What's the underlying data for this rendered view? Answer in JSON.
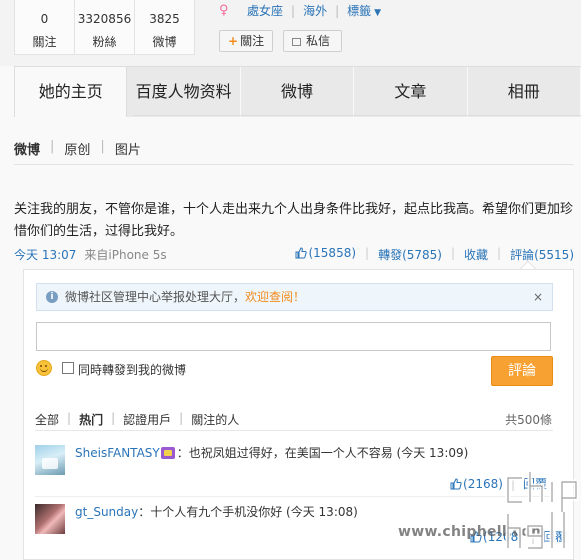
{
  "profile": {
    "stats": [
      {
        "num": "0",
        "label": "關注"
      },
      {
        "num": "3320856",
        "label": "粉絲"
      },
      {
        "num": "3825",
        "label": "微博"
      }
    ],
    "zodiac": "處女座",
    "location": "海外",
    "tags": "標籤",
    "follow_label": "關注",
    "message_label": "私信"
  },
  "tabs": [
    "她的主页",
    "百度人物资料",
    "微博",
    "文章",
    "相冊"
  ],
  "subnav": [
    "微博",
    "原创",
    "图片"
  ],
  "post": {
    "text": "关注我的朋友，不管你是谁，十个人走出来九个人出身条件比我好，起点比我高。希望你们更加珍惜你们的生活，过得比我好。",
    "time": "今天 13:07",
    "source": "来自iPhone 5s",
    "likes": "(15858)",
    "repost": "轉發(5785)",
    "favorite": "收藏",
    "comment": "評論(5515)"
  },
  "comment_box": {
    "notice_text": "微博社区管理中心举报处理大厅，",
    "notice_link": "欢迎查阅！",
    "close": "×",
    "repost_option": "同時轉發到我的微博",
    "submit": "評論"
  },
  "filters": {
    "all": "全部",
    "hot": "热门",
    "verified": "認證用戶",
    "following": "關注的人",
    "total": "共500條"
  },
  "comments": [
    {
      "user": "SheisFANTASY",
      "text": "：也祝凤姐过得好，在美国一个人不容易 (今天 13:09)",
      "likes": "(2168)",
      "reply": "回覆"
    },
    {
      "user": "gt_Sunday",
      "text": "：十个人有九个手机没你好 (今天 13:08)",
      "likes": "(1208)",
      "reply": "回覆"
    }
  ],
  "watermark": {
    "url": "www.chiphell.com",
    "logo": "chip hell"
  },
  "colors": {
    "link": "#2a74b8",
    "accent": "#f7a133"
  }
}
